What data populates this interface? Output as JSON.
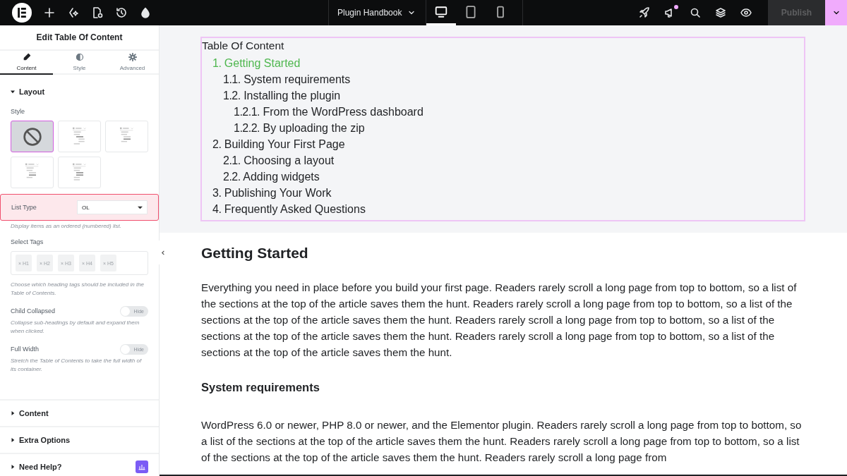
{
  "topbar": {
    "document": "Plugin Handbook",
    "devices": [
      {
        "kind": "desktop",
        "selected": true
      },
      {
        "kind": "tablet",
        "selected": false
      },
      {
        "kind": "mobile",
        "selected": false
      }
    ],
    "news_unread": true,
    "publish": "Publish",
    "publish_disabled": true
  },
  "panel": {
    "title": "Edit Table Of Content",
    "tabs": [
      {
        "label": "Content",
        "selected": true
      },
      {
        "label": "Style",
        "selected": false
      },
      {
        "label": "Advanced",
        "selected": false
      }
    ],
    "layout": {
      "heading": "Layout",
      "expanded": true,
      "style_label": "Style",
      "styles": [
        {
          "kind": "none",
          "selected": true
        },
        {
          "kind": "nested",
          "selected": false
        },
        {
          "kind": "marked",
          "selected": false
        },
        {
          "kind": "marked",
          "selected": false
        },
        {
          "kind": "numbered",
          "selected": false
        }
      ],
      "list_type": {
        "label": "List Type",
        "value": "OL",
        "highlighted": true,
        "help": "Display items as an ordered (numbered) list."
      },
      "select_tags": {
        "label": "Select Tags",
        "tags": [
          {
            "label": "× H1",
            "disabled": true
          },
          {
            "label": "× H2",
            "disabled": true
          },
          {
            "label": "× H3",
            "disabled": true
          },
          {
            "label": "× H4",
            "disabled": true
          },
          {
            "label": "× H5",
            "disabled": true
          }
        ],
        "help": "Choose which heading tags should be included in the Table of Contents."
      },
      "switches": [
        {
          "label": "Child Collapsed",
          "on": false,
          "state": "Hide",
          "help": "Collapse sub-headings by default and expand them when clicked."
        },
        {
          "label": "Full Width",
          "on": false,
          "state": "Hide",
          "help": "Stretch the Table of Contents to take the full width of its container."
        }
      ]
    },
    "sections": [
      {
        "heading": "Content",
        "expanded": false
      },
      {
        "heading": "Extra Options",
        "expanded": false
      },
      {
        "heading": "Need Help?",
        "expanded": false,
        "badge": true
      }
    ]
  },
  "canvas": {
    "toc": {
      "title": "Table Of Content",
      "items": [
        {
          "number": "1.",
          "title": "Getting Started",
          "selected": true,
          "children": [
            {
              "number": "1.1.",
              "title": "System requirements",
              "selected": false
            },
            {
              "number": "1.2.",
              "title": "Installing the plugin",
              "selected": false,
              "children": [
                {
                  "number": "1.2.1.",
                  "title": "From the WordPress dashboard",
                  "selected": false
                },
                {
                  "number": "1.2.2.",
                  "title": "By uploading the zip",
                  "selected": false
                }
              ]
            }
          ]
        },
        {
          "number": "2.",
          "title": "Building Your First Page",
          "selected": false,
          "children": [
            {
              "number": "2.1.",
              "title": "Choosing a layout",
              "selected": false
            },
            {
              "number": "2.2.",
              "title": "Adding widgets",
              "selected": false
            }
          ]
        },
        {
          "number": "3.",
          "title": "Publishing Your Work",
          "selected": false
        },
        {
          "number": "4.",
          "title": "Frequently Asked Questions",
          "selected": false
        }
      ]
    },
    "article": [
      {
        "kind": "h2",
        "text": "Getting Started"
      },
      {
        "kind": "p",
        "text": "Everything you need in place before you build your first page. Readers rarely scroll a long page from top to bottom, so a list of the sections at the top of the article saves them the hunt. Readers rarely scroll a long page from top to bottom, so a list of the sections at the top of the article saves them the hunt. Readers rarely scroll a long page from top to bottom, so a list of the sections at the top of the article saves them the hunt. Readers rarely scroll a long page from top to bottom, so a list of the sections at the top of the article saves them the hunt."
      },
      {
        "kind": "h3",
        "text": "System requirements"
      },
      {
        "kind": "p",
        "text": "WordPress 6.0 or newer, PHP 8.0 or newer, and the Elementor plugin. Readers rarely scroll a long page from top to bottom, so a list of the sections at the top of the article saves them the hunt. Readers rarely scroll a long page from top to bottom, so a list of the sections at the top of the article saves them the hunt. Readers rarely scroll a long page from"
      }
    ]
  }
}
